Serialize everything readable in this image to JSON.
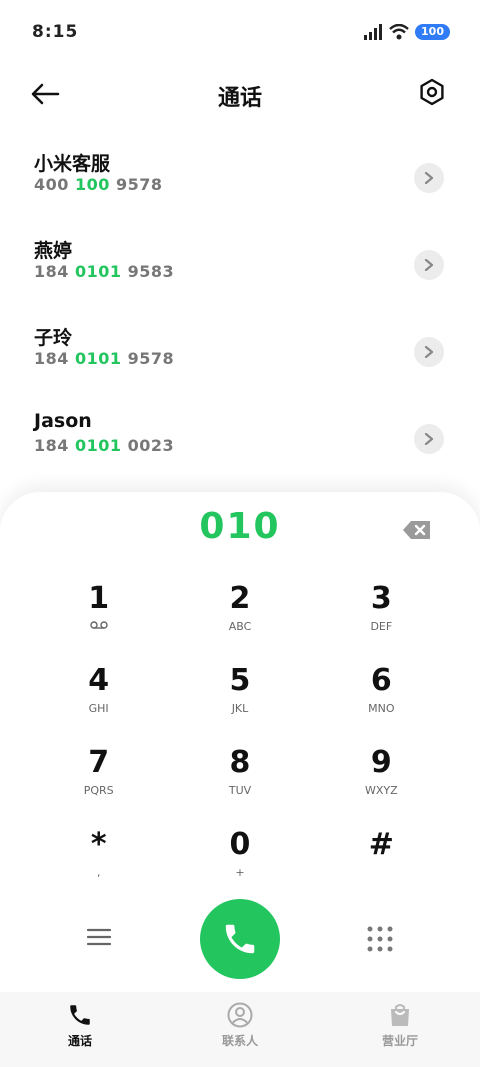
{
  "status_bar": {
    "time": "8:15",
    "battery": "100"
  },
  "header": {
    "title": "通话",
    "back_icon": "back-arrow-icon",
    "settings_icon": "settings-icon"
  },
  "contacts": [
    {
      "name": "小米客服",
      "number_pre": "400 ",
      "number_hl": "100",
      "number_post": " 9578"
    },
    {
      "name": "燕婷",
      "number_pre": "184 ",
      "number_hl": "0101",
      "number_post": " 9583"
    },
    {
      "name": "子玲",
      "number_pre": "184 ",
      "number_hl": "0101",
      "number_post": " 9578"
    },
    {
      "name": "Jason",
      "number_pre": "184 ",
      "number_hl": "0101",
      "number_post": " 0023"
    }
  ],
  "dialer": {
    "display": "010",
    "keys": [
      {
        "digit": "1",
        "sub": "voicemail-icon"
      },
      {
        "digit": "2",
        "sub": "ABC"
      },
      {
        "digit": "3",
        "sub": "DEF"
      },
      {
        "digit": "4",
        "sub": "GHI"
      },
      {
        "digit": "5",
        "sub": "JKL"
      },
      {
        "digit": "6",
        "sub": "MNO"
      },
      {
        "digit": "7",
        "sub": "PQRS"
      },
      {
        "digit": "8",
        "sub": "TUV"
      },
      {
        "digit": "9",
        "sub": "WXYZ"
      },
      {
        "digit": "*",
        "sub": ","
      },
      {
        "digit": "0",
        "sub": "+"
      },
      {
        "digit": "#",
        "sub": ""
      }
    ]
  },
  "bottom_nav": {
    "items": [
      {
        "label": "通话",
        "icon": "phone-icon",
        "active": true
      },
      {
        "label": "联系人",
        "icon": "person-icon",
        "active": false
      },
      {
        "label": "营业厅",
        "icon": "shopping-bag-icon",
        "active": false
      }
    ]
  },
  "colors": {
    "accent": "#22c55e",
    "battery": "#2f7cf6"
  }
}
